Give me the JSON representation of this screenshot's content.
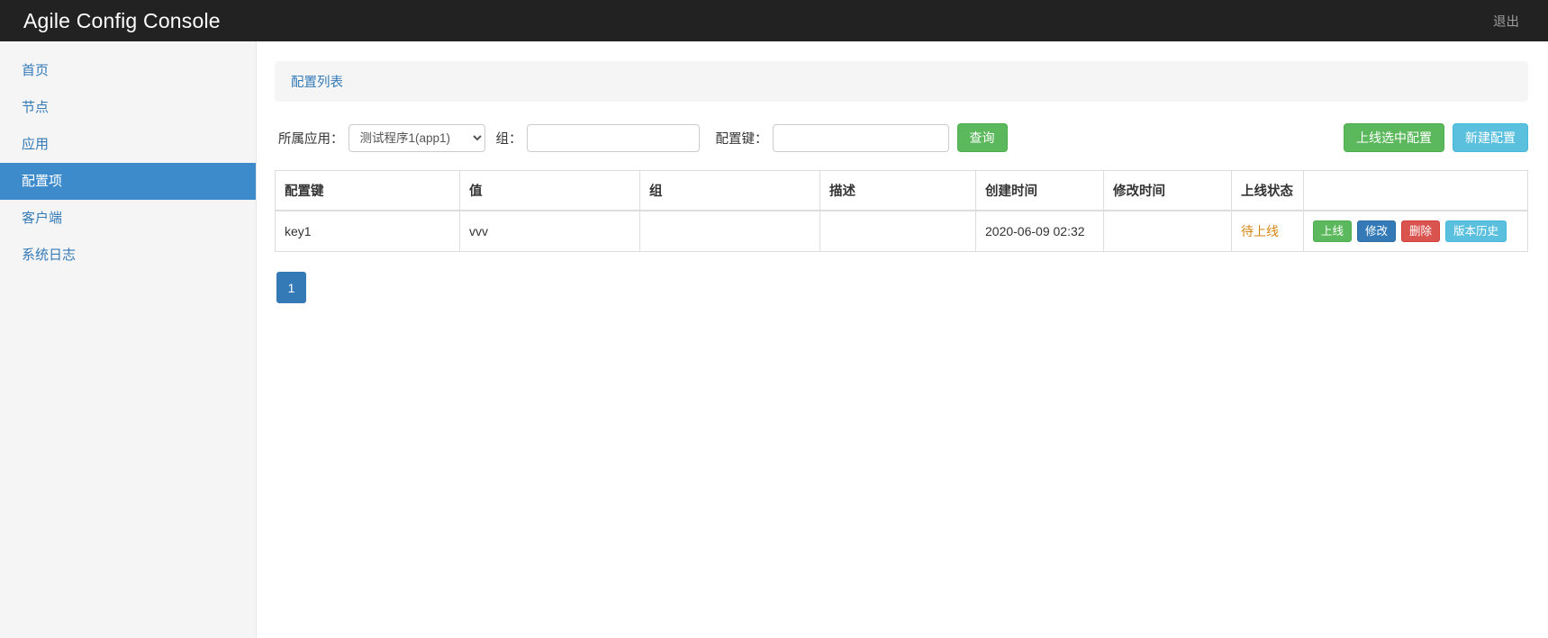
{
  "navbar": {
    "brand": "Agile Config Console",
    "logout_label": "退出"
  },
  "sidebar": {
    "items": [
      {
        "label": "首页",
        "active": false
      },
      {
        "label": "节点",
        "active": false
      },
      {
        "label": "应用",
        "active": false
      },
      {
        "label": "配置项",
        "active": true
      },
      {
        "label": "客户端",
        "active": false
      },
      {
        "label": "系统日志",
        "active": false
      }
    ]
  },
  "breadcrumb": {
    "label": "配置列表"
  },
  "filter": {
    "app_label": "所属应用：",
    "app_selected": "测试程序1(app1)",
    "app_options": [
      "测试程序1(app1)"
    ],
    "group_label": "组：",
    "group_value": "",
    "group_placeholder": "",
    "key_label": "配置键：",
    "key_value": "",
    "key_placeholder": "",
    "query_button": "查询",
    "publish_selected_button": "上线选中配置",
    "new_config_button": "新建配置"
  },
  "table": {
    "headers": [
      "配置键",
      "值",
      "组",
      "描述",
      "创建时间",
      "修改时间",
      "上线状态",
      ""
    ],
    "rows": [
      {
        "key": "key1",
        "value": "vvv",
        "group": "",
        "description": "",
        "created_at": "2020-06-09 02:32",
        "modified_at": "",
        "status": "待上线",
        "actions": [
          {
            "label": "上线",
            "style": "green"
          },
          {
            "label": "修改",
            "style": "primary"
          },
          {
            "label": "删除",
            "style": "danger"
          },
          {
            "label": "版本历史",
            "style": "info"
          }
        ]
      }
    ]
  },
  "pagination": {
    "pages": [
      "1"
    ],
    "current": "1"
  },
  "colors": {
    "navbar_bg": "#222222",
    "sidebar_bg": "#f5f5f5",
    "active_nav": "#3e8bcc",
    "link": "#337ab7",
    "success": "#5cb85c",
    "info": "#5bc0de",
    "danger": "#d9534f",
    "warning": "#d58512"
  }
}
